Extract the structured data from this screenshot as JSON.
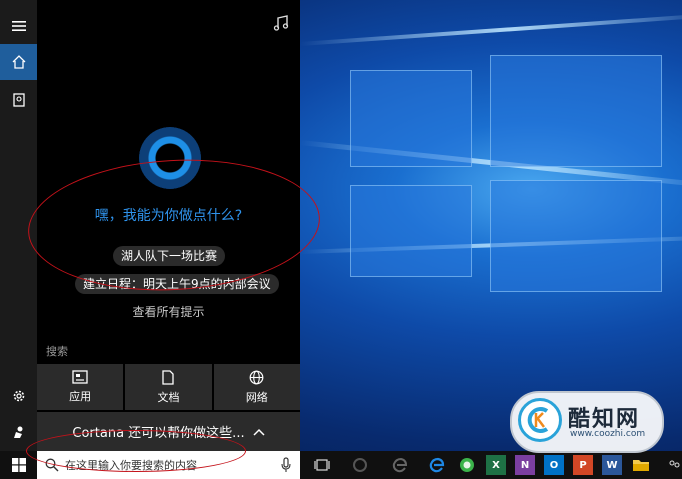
{
  "cortana": {
    "greeting": "嘿，我能为你做点什么?",
    "suggestions": [
      "湖人队下一场比赛",
      "建立日程：明天上午9点的内部会议"
    ],
    "see_all": "查看所有提示",
    "search_section_label": "搜索",
    "tiles": [
      {
        "label": "应用",
        "icon": "app-icon"
      },
      {
        "label": "文档",
        "icon": "document-icon"
      },
      {
        "label": "网络",
        "icon": "globe-icon"
      }
    ],
    "more_bar_label": "Cortana 还可以帮你做这些...",
    "accent_color": "#1f5e9c"
  },
  "left_rail": {
    "items": [
      "hamburger-menu-icon",
      "home-icon",
      "notebook-icon",
      "settings-icon",
      "feedback-icon"
    ]
  },
  "taskbar": {
    "search_placeholder": "在这里输入你要搜索的内容",
    "apps": [
      "task-view",
      "edge",
      "360-browser",
      "excel",
      "onenote",
      "outlook",
      "powerpoint",
      "word",
      "file-explorer"
    ]
  },
  "watermark": {
    "brand": "酷知网",
    "url": "www.coozhi.com"
  }
}
